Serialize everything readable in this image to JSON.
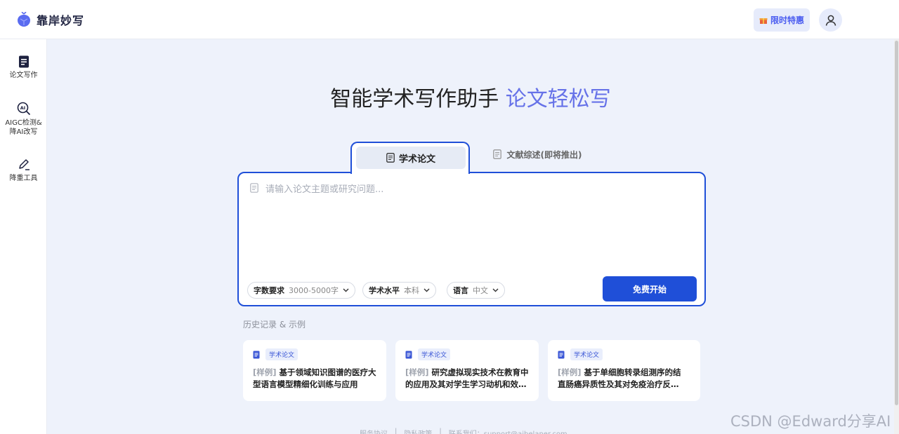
{
  "app": {
    "name": "靠岸妙写"
  },
  "header": {
    "promo_label": "限时特惠"
  },
  "sidebar": {
    "items": [
      {
        "label": "论文写作",
        "icon": "document-icon"
      },
      {
        "label": "AIGC检测&降AI改写",
        "icon": "ai-magnifier-icon"
      },
      {
        "label": "降重工具",
        "icon": "pencil-icon"
      }
    ]
  },
  "hero": {
    "title": "智能学术写作助手",
    "accent": "论文轻松写"
  },
  "tabs": [
    {
      "label": "学术论文",
      "active": true
    },
    {
      "label": "文献综述(即将推出)",
      "active": false
    }
  ],
  "topic": {
    "placeholder": "请输入论文主题或研究问题...",
    "value": ""
  },
  "options": {
    "word_count": {
      "label": "字数要求",
      "value": "3000-5000字"
    },
    "level": {
      "label": "学术水平",
      "value": "本科"
    },
    "language": {
      "label": "语言",
      "value": "中文"
    }
  },
  "start_button": "免费开始",
  "history": {
    "title": "历史记录 & 示例",
    "items": [
      {
        "tag": "学术论文",
        "prefix": "[样例]",
        "title": "基于领域知识图谱的医疗大型语言模型精细化训练与应用"
      },
      {
        "tag": "学术论文",
        "prefix": "[样例]",
        "title": "研究虚拟现实技术在教育中的应用及其对学生学习动机和效果的影响"
      },
      {
        "tag": "学术论文",
        "prefix": "[样例]",
        "title": "基于单细胞转录组测序的结直肠癌异质性及其对免疫治疗反应的研究"
      }
    ]
  },
  "footer": {
    "terms": "服务协议",
    "privacy": "隐私政策",
    "contact": "联系我们：support@aibelaner.com"
  },
  "watermark": "CSDN @Edward分享AI",
  "colors": {
    "primary": "#1f4fd8",
    "accent": "#6672e8",
    "background": "#eef2fb"
  }
}
